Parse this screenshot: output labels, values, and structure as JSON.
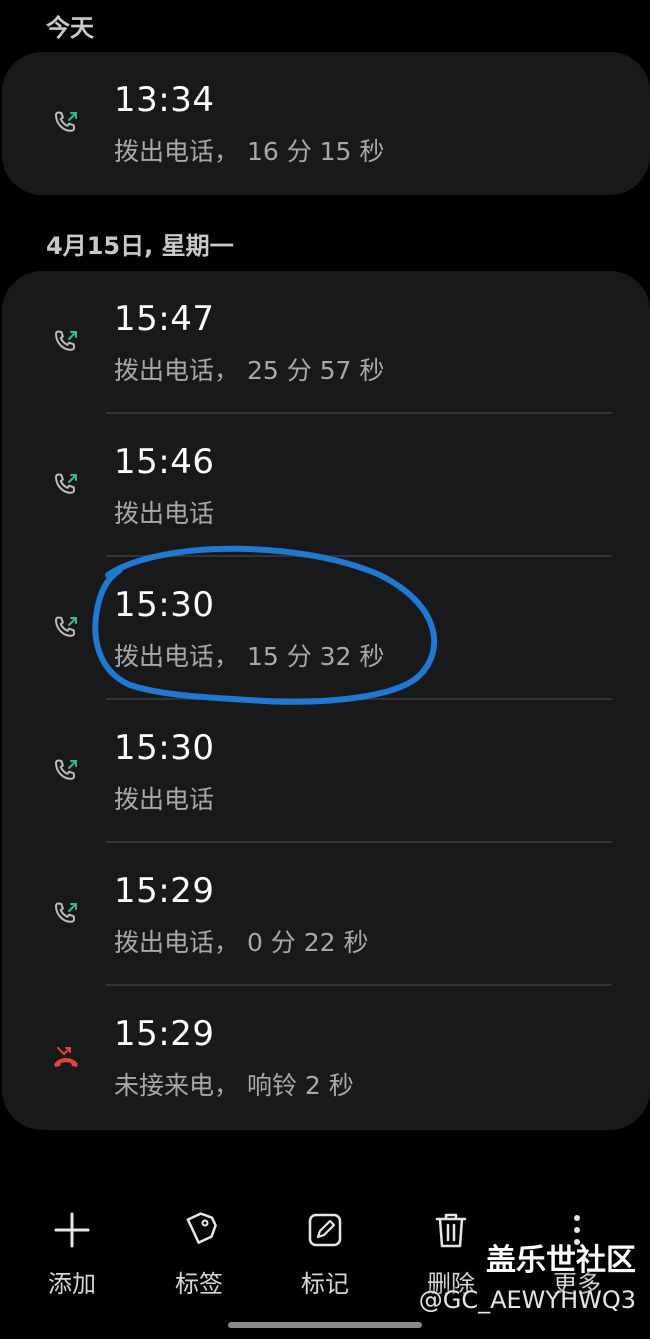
{
  "today": {
    "header": "今天",
    "calls": [
      {
        "time": "13:34",
        "detail": "拨出电话， 16 分 15 秒",
        "type": "outgoing"
      }
    ]
  },
  "earlier": {
    "header": "4月15日, 星期一",
    "calls": [
      {
        "time": "15:47",
        "detail": "拨出电话， 25 分 57 秒",
        "type": "outgoing"
      },
      {
        "time": "15:46",
        "detail": "拨出电话",
        "type": "outgoing"
      },
      {
        "time": "15:30",
        "detail": "拨出电话， 15 分 32 秒",
        "type": "outgoing"
      },
      {
        "time": "15:30",
        "detail": "拨出电话",
        "type": "outgoing"
      },
      {
        "time": "15:29",
        "detail": "拨出电话， 0 分 22 秒",
        "type": "outgoing"
      },
      {
        "time": "15:29",
        "detail": "未接来电， 响铃 2 秒",
        "type": "missed"
      }
    ]
  },
  "toolbar": {
    "add_label": "添加",
    "tag_label": "标签",
    "mark_label": "标记",
    "delete_label": "删除",
    "more_label": "更多"
  },
  "watermark": {
    "brand": "盖乐世社区",
    "handle": "@GC_AEWYHWQ3"
  },
  "icons": {
    "outgoing": "outgoing-call-icon",
    "missed": "missed-call-icon",
    "add": "plus-icon",
    "tag": "tag-icon",
    "mark": "edit-icon",
    "delete": "trash-icon",
    "more": "more-vertical-icon"
  },
  "colors": {
    "background": "#000000",
    "card": "#19191b",
    "outgoing_arrow": "#2fbf85",
    "missed": "#e0453d",
    "annotation_circle": "#1f78d1"
  }
}
